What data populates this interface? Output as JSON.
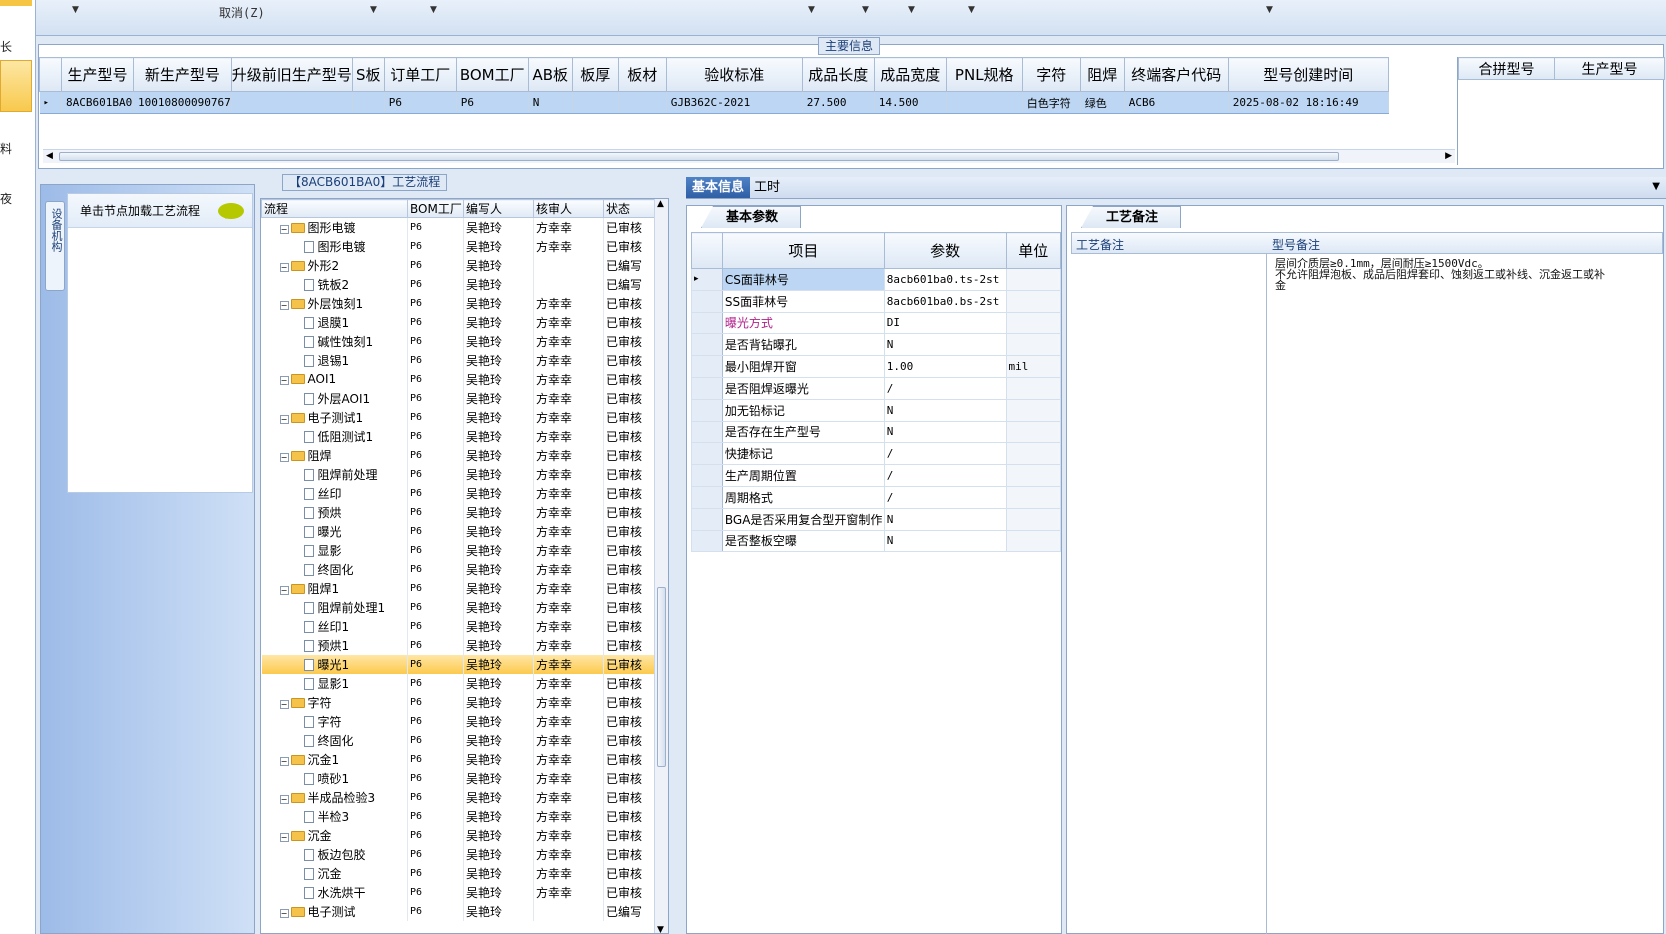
{
  "toolbar": {
    "cancel_label": "取消(Z)"
  },
  "left_strip": {
    "items": [
      "长",
      "料",
      "夜"
    ]
  },
  "main_info": {
    "title": "主要信息",
    "columns": [
      "生产型号",
      "新生产型号",
      "升级前旧生产型号",
      "S板",
      "订单工厂",
      "BOM工厂",
      "AB板",
      "板厚",
      "板材",
      "验收标准",
      "成品长度",
      "成品宽度",
      "PNL规格",
      "字符",
      "阻焊",
      "终端客户代码",
      "型号创建时间"
    ],
    "row": [
      "8ACB601BA0",
      "10010800090767",
      "",
      "",
      "P6",
      "P6",
      "N",
      "",
      "",
      "GJB362C-2021",
      "27.500",
      "14.500",
      "",
      "白色字符",
      "绿色",
      "ACB6",
      "2025-08-02 18:16:49"
    ],
    "merge_columns": [
      "合拼型号",
      "生产型号"
    ]
  },
  "process": {
    "title": "【8ACB601BA0】工艺流程",
    "nav_tab": "设备机构",
    "nav_header": "单击节点加载工艺流程",
    "columns": [
      "流程",
      "BOM工厂",
      "编写人",
      "核审人",
      "状态"
    ],
    "rows": [
      {
        "level": 0,
        "name": "图形电镀",
        "bom": "P6",
        "writer": "吴艳玲",
        "checker": "方幸幸",
        "status": "已审核"
      },
      {
        "level": 1,
        "name": "图形电镀",
        "bom": "P6",
        "writer": "吴艳玲",
        "checker": "方幸幸",
        "status": "已审核"
      },
      {
        "level": 0,
        "name": "外形2",
        "bom": "P6",
        "writer": "吴艳玲",
        "checker": "",
        "status": "已编写"
      },
      {
        "level": 1,
        "name": "铣板2",
        "bom": "P6",
        "writer": "吴艳玲",
        "checker": "",
        "status": "已编写"
      },
      {
        "level": 0,
        "name": "外层蚀刻1",
        "bom": "P6",
        "writer": "吴艳玲",
        "checker": "方幸幸",
        "status": "已审核"
      },
      {
        "level": 1,
        "name": "退膜1",
        "bom": "P6",
        "writer": "吴艳玲",
        "checker": "方幸幸",
        "status": "已审核"
      },
      {
        "level": 1,
        "name": "碱性蚀刻1",
        "bom": "P6",
        "writer": "吴艳玲",
        "checker": "方幸幸",
        "status": "已审核"
      },
      {
        "level": 1,
        "name": "退锡1",
        "bom": "P6",
        "writer": "吴艳玲",
        "checker": "方幸幸",
        "status": "已审核"
      },
      {
        "level": 0,
        "name": "AOI1",
        "bom": "P6",
        "writer": "吴艳玲",
        "checker": "方幸幸",
        "status": "已审核"
      },
      {
        "level": 1,
        "name": "外层AOI1",
        "bom": "P6",
        "writer": "吴艳玲",
        "checker": "方幸幸",
        "status": "已审核"
      },
      {
        "level": 0,
        "name": "电子测试1",
        "bom": "P6",
        "writer": "吴艳玲",
        "checker": "方幸幸",
        "status": "已审核"
      },
      {
        "level": 1,
        "name": "低阻测试1",
        "bom": "P6",
        "writer": "吴艳玲",
        "checker": "方幸幸",
        "status": "已审核"
      },
      {
        "level": 0,
        "name": "阻焊",
        "bom": "P6",
        "writer": "吴艳玲",
        "checker": "方幸幸",
        "status": "已审核"
      },
      {
        "level": 1,
        "name": "阻焊前处理",
        "bom": "P6",
        "writer": "吴艳玲",
        "checker": "方幸幸",
        "status": "已审核"
      },
      {
        "level": 1,
        "name": "丝印",
        "bom": "P6",
        "writer": "吴艳玲",
        "checker": "方幸幸",
        "status": "已审核"
      },
      {
        "level": 1,
        "name": "预烘",
        "bom": "P6",
        "writer": "吴艳玲",
        "checker": "方幸幸",
        "status": "已审核"
      },
      {
        "level": 1,
        "name": "曝光",
        "bom": "P6",
        "writer": "吴艳玲",
        "checker": "方幸幸",
        "status": "已审核"
      },
      {
        "level": 1,
        "name": "显影",
        "bom": "P6",
        "writer": "吴艳玲",
        "checker": "方幸幸",
        "status": "已审核"
      },
      {
        "level": 1,
        "name": "终固化",
        "bom": "P6",
        "writer": "吴艳玲",
        "checker": "方幸幸",
        "status": "已审核"
      },
      {
        "level": 0,
        "name": "阻焊1",
        "bom": "P6",
        "writer": "吴艳玲",
        "checker": "方幸幸",
        "status": "已审核"
      },
      {
        "level": 1,
        "name": "阻焊前处理1",
        "bom": "P6",
        "writer": "吴艳玲",
        "checker": "方幸幸",
        "status": "已审核"
      },
      {
        "level": 1,
        "name": "丝印1",
        "bom": "P6",
        "writer": "吴艳玲",
        "checker": "方幸幸",
        "status": "已审核"
      },
      {
        "level": 1,
        "name": "预烘1",
        "bom": "P6",
        "writer": "吴艳玲",
        "checker": "方幸幸",
        "status": "已审核"
      },
      {
        "level": 1,
        "name": "曝光1",
        "bom": "P6",
        "writer": "吴艳玲",
        "checker": "方幸幸",
        "status": "已审核",
        "selected": true
      },
      {
        "level": 1,
        "name": "显影1",
        "bom": "P6",
        "writer": "吴艳玲",
        "checker": "方幸幸",
        "status": "已审核"
      },
      {
        "level": 0,
        "name": "字符",
        "bom": "P6",
        "writer": "吴艳玲",
        "checker": "方幸幸",
        "status": "已审核"
      },
      {
        "level": 1,
        "name": "字符",
        "bom": "P6",
        "writer": "吴艳玲",
        "checker": "方幸幸",
        "status": "已审核"
      },
      {
        "level": 1,
        "name": "终固化",
        "bom": "P6",
        "writer": "吴艳玲",
        "checker": "方幸幸",
        "status": "已审核"
      },
      {
        "level": 0,
        "name": "沉金1",
        "bom": "P6",
        "writer": "吴艳玲",
        "checker": "方幸幸",
        "status": "已审核"
      },
      {
        "level": 1,
        "name": "喷砂1",
        "bom": "P6",
        "writer": "吴艳玲",
        "checker": "方幸幸",
        "status": "已审核"
      },
      {
        "level": 0,
        "name": "半成品检验3",
        "bom": "P6",
        "writer": "吴艳玲",
        "checker": "方幸幸",
        "status": "已审核"
      },
      {
        "level": 1,
        "name": "半检3",
        "bom": "P6",
        "writer": "吴艳玲",
        "checker": "方幸幸",
        "status": "已审核"
      },
      {
        "level": 0,
        "name": "沉金",
        "bom": "P6",
        "writer": "吴艳玲",
        "checker": "方幸幸",
        "status": "已审核"
      },
      {
        "level": 1,
        "name": "板边包胶",
        "bom": "P6",
        "writer": "吴艳玲",
        "checker": "方幸幸",
        "status": "已审核"
      },
      {
        "level": 1,
        "name": "沉金",
        "bom": "P6",
        "writer": "吴艳玲",
        "checker": "方幸幸",
        "status": "已审核"
      },
      {
        "level": 1,
        "name": "水洗烘干",
        "bom": "P6",
        "writer": "吴艳玲",
        "checker": "方幸幸",
        "status": "已审核"
      },
      {
        "level": 0,
        "name": "电子测试",
        "bom": "P6",
        "writer": "吴艳玲",
        "checker": "",
        "status": "已编写"
      }
    ]
  },
  "tabs": {
    "basic": "基本信息",
    "hours": "工时"
  },
  "params": {
    "title": "基本参数",
    "columns": [
      "项目",
      "参数",
      "单位"
    ],
    "rows": [
      {
        "item": "CS面菲林号",
        "value": "8acb601ba0.ts-2st",
        "unit": "",
        "selected": true
      },
      {
        "item": "SS面菲林号",
        "value": "8acb601ba0.bs-2st",
        "unit": ""
      },
      {
        "item": "曝光方式",
        "value": "DI",
        "unit": "",
        "highlight": true
      },
      {
        "item": "是否背钻曝孔",
        "value": "N",
        "unit": ""
      },
      {
        "item": "最小阻焊开窗",
        "value": "1.00",
        "unit": "mil"
      },
      {
        "item": "是否阻焊返曝光",
        "value": "/",
        "unit": ""
      },
      {
        "item": "加无铅标记",
        "value": "N",
        "unit": ""
      },
      {
        "item": "是否存在生产型号",
        "value": "N",
        "unit": ""
      },
      {
        "item": "快捷标记",
        "value": "/",
        "unit": ""
      },
      {
        "item": "生产周期位置",
        "value": "/",
        "unit": ""
      },
      {
        "item": "周期格式",
        "value": "/",
        "unit": ""
      },
      {
        "item": "BGA是否采用复合型开窗制作",
        "value": "N",
        "unit": ""
      },
      {
        "item": "是否整板空曝",
        "value": "N",
        "unit": ""
      }
    ],
    "highlight_color": "#b0208a"
  },
  "remarks": {
    "title": "工艺备注",
    "col1": "工艺备注",
    "col2": "型号备注",
    "text_lines": [
      "层间介质层≥0.1mm，层间耐压≥1500Vdc。",
      "不允许阻焊泡板、成品后阻焊套印、蚀刻返工或补线、沉金返工或补",
      "金"
    ]
  }
}
